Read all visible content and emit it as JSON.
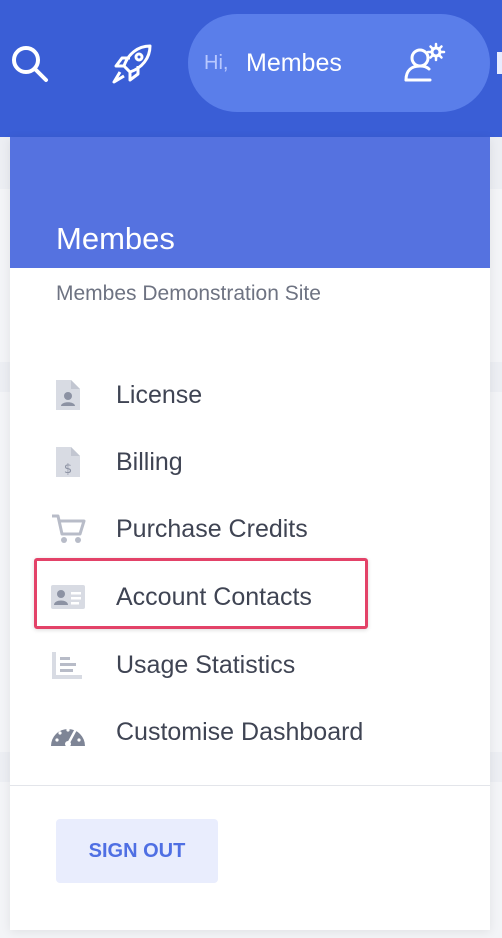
{
  "topbar": {
    "greeting": "Hi,",
    "user_name": "Membes",
    "icons": [
      "search-icon",
      "rocket-icon",
      "user-cog-icon"
    ]
  },
  "dropdown": {
    "title": "Membes",
    "subtitle": "Membes Demonstration Site",
    "menu": [
      {
        "label": "License",
        "icon": "license-doc-icon"
      },
      {
        "label": "Billing",
        "icon": "billing-doc-icon"
      },
      {
        "label": "Purchase Credits",
        "icon": "cart-icon"
      },
      {
        "label": "Account Contacts",
        "icon": "contact-card-icon",
        "highlighted": true
      },
      {
        "label": "Usage Statistics",
        "icon": "bar-chart-icon"
      },
      {
        "label": "Customise Dashboard",
        "icon": "gauge-icon"
      }
    ],
    "sign_out": "SIGN OUT"
  },
  "colors": {
    "topbar": "#3a5ed6",
    "header": "#5572e0",
    "highlight": "#e34268",
    "signout_text": "#4f6fe3"
  }
}
